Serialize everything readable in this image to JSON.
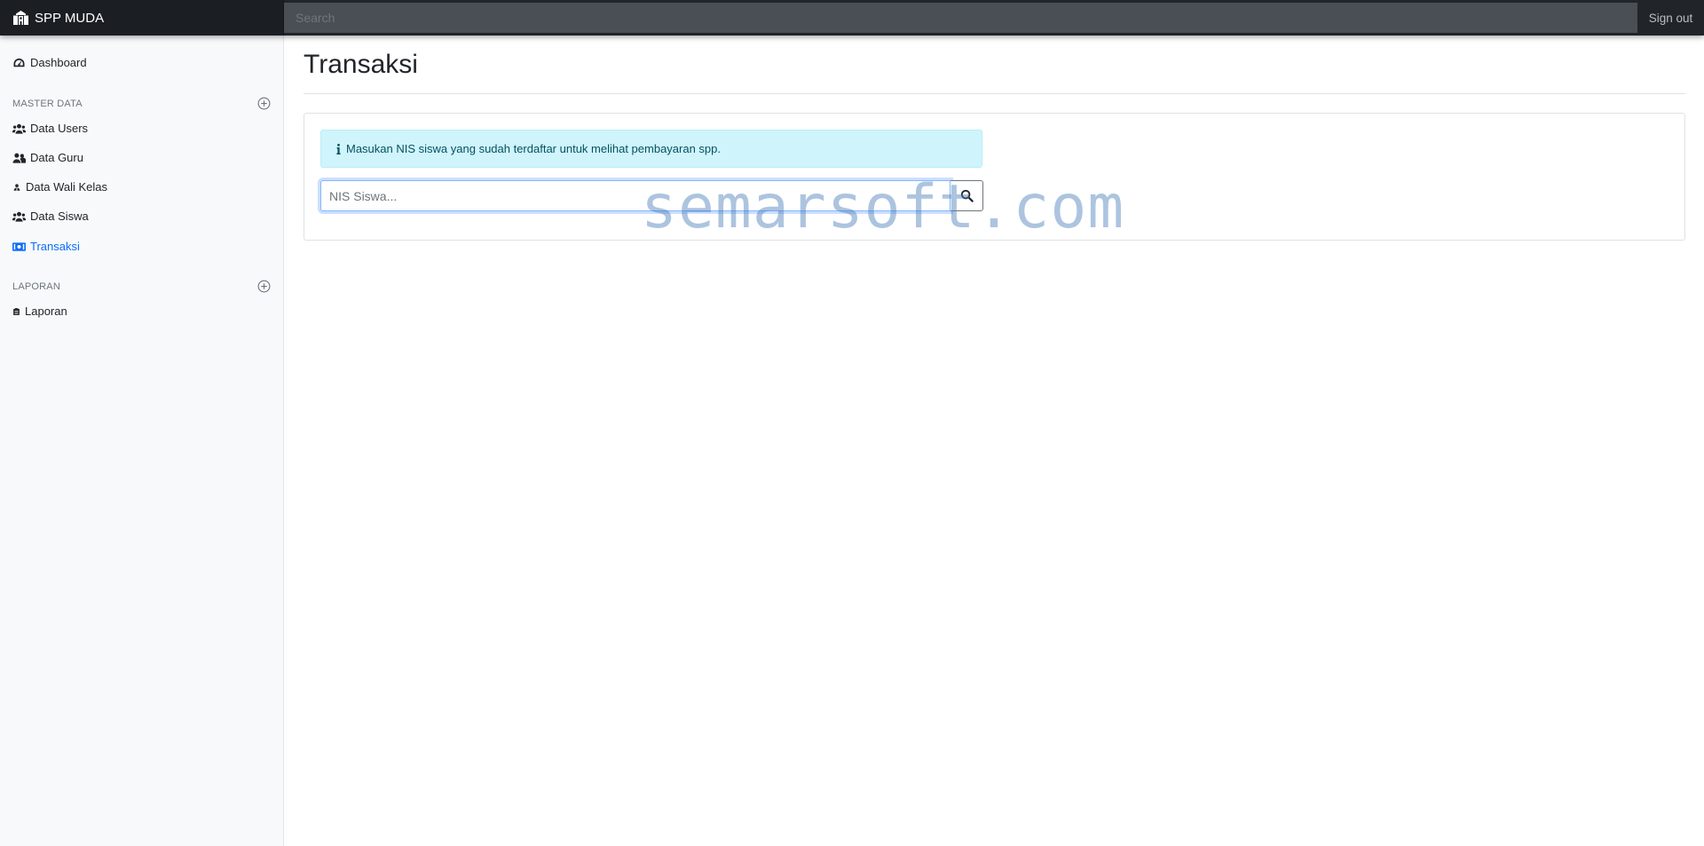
{
  "navbar": {
    "brand": "SPP MUDA",
    "brand_icon": "school-icon",
    "search_placeholder": "Search",
    "signout": "Sign out"
  },
  "sidebar": {
    "dashboard": {
      "label": "Dashboard",
      "icon": "gauge-icon"
    },
    "sections": [
      {
        "heading": "MASTER DATA",
        "items": [
          {
            "label": "Data Users",
            "icon": "users-icon"
          },
          {
            "label": "Data Guru",
            "icon": "user-friends-icon"
          },
          {
            "label": "Data Wali Kelas",
            "icon": "user-tie-icon"
          },
          {
            "label": "Data Siswa",
            "icon": "users-icon"
          },
          {
            "label": "Transaksi",
            "icon": "money-bill-icon",
            "active": true
          }
        ]
      },
      {
        "heading": "LAPORAN",
        "items": [
          {
            "label": "Laporan",
            "icon": "clipboard-icon"
          }
        ]
      }
    ]
  },
  "main": {
    "title": "Transaksi",
    "alert_text": "Masukan NIS siswa yang sudah terdaftar untuk melihat pembayaran spp.",
    "nis_placeholder": "NIS Siswa...",
    "nis_value": ""
  },
  "watermark": "semarsoft.com",
  "colors": {
    "navbar_bg": "#212529",
    "sidebar_bg": "#f8f9fa",
    "active_link": "#0d6efd",
    "alert_bg": "#cff4fc",
    "alert_text": "#055160"
  }
}
